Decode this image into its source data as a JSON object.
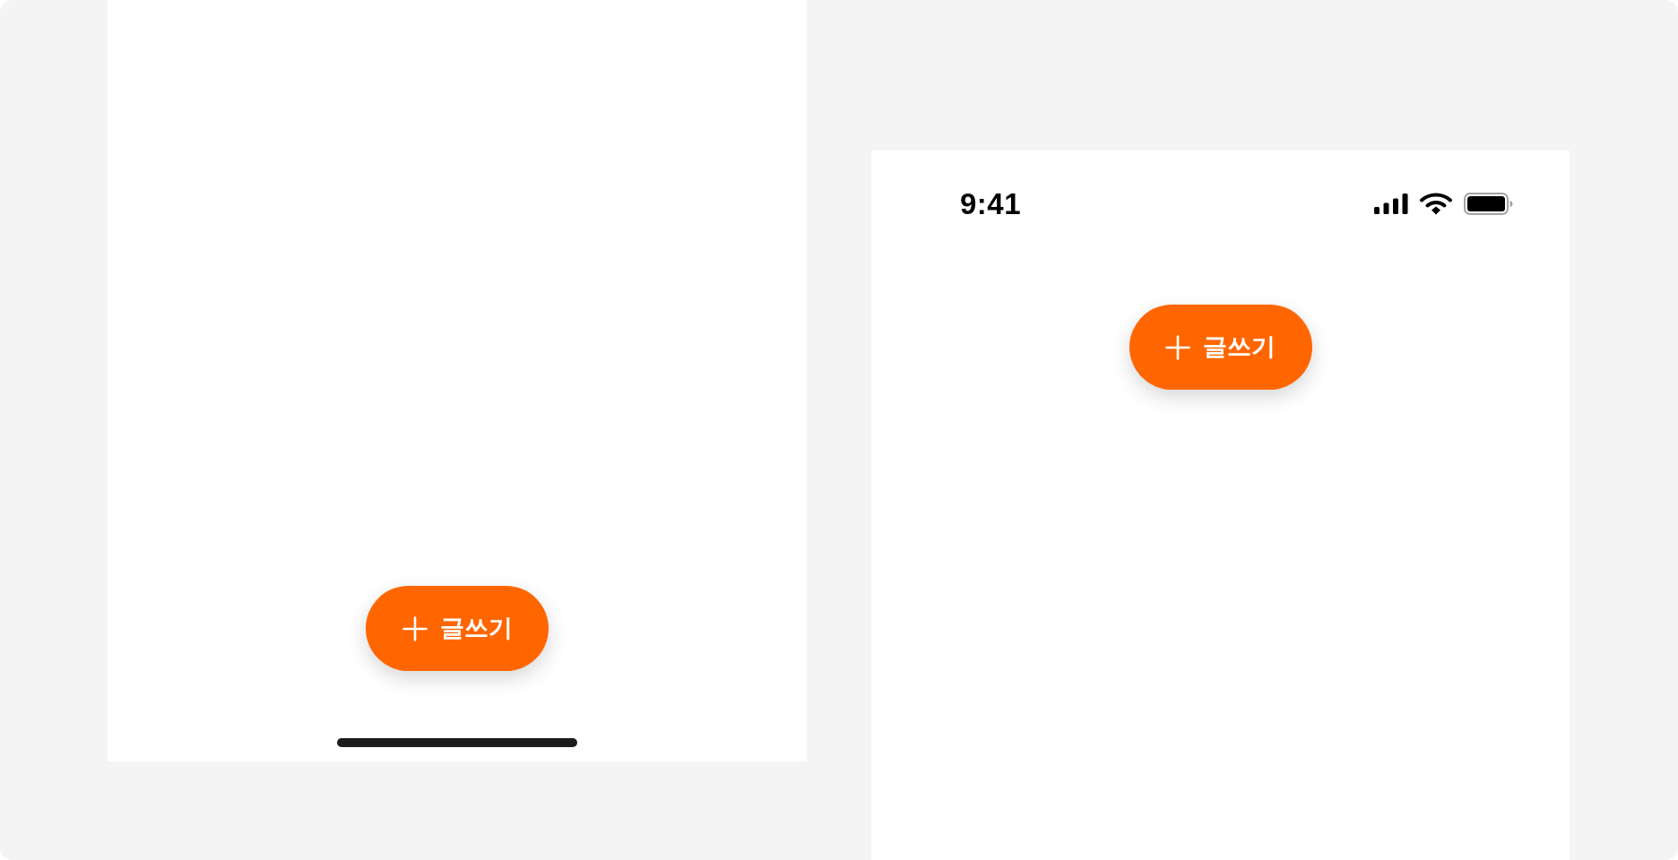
{
  "screens": [
    {
      "kind": "bottom",
      "button": {
        "label": "글쓰기"
      }
    },
    {
      "kind": "top",
      "status_bar": {
        "time": "9:41"
      },
      "button": {
        "label": "글쓰기"
      }
    }
  ]
}
